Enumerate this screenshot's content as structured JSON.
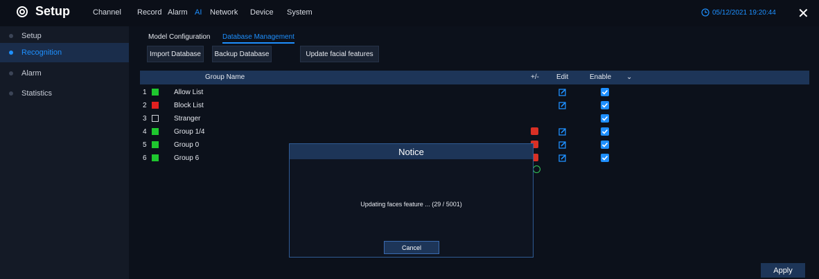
{
  "app": {
    "title": "Setup"
  },
  "menu": [
    "Channel",
    "Record",
    "Alarm",
    "AI",
    "Network",
    "Device",
    "System"
  ],
  "datetime": "05/12/2021 19:20:44",
  "sidebar": [
    "Setup",
    "Recognition",
    "Alarm",
    "Statistics"
  ],
  "subtabs": [
    "Model Configuration",
    "Database Management"
  ],
  "buttons": {
    "import": "Import Database",
    "backup": "Backup Database",
    "update": "Update facial features"
  },
  "table": {
    "headers": {
      "group_name": "Group Name",
      "plusminus": "+/-",
      "edit": "Edit",
      "enable": "Enable"
    },
    "rows": [
      {
        "num": "1",
        "color": "#1ec72e",
        "name": "Allow List",
        "deletable": false,
        "editable": true,
        "enabled": true
      },
      {
        "num": "2",
        "color": "#e02020",
        "name": "Block List",
        "deletable": false,
        "editable": true,
        "enabled": true
      },
      {
        "num": "3",
        "color": "none",
        "name": "Stranger",
        "deletable": false,
        "editable": false,
        "enabled": true
      },
      {
        "num": "4",
        "color": "#1ec72e",
        "name": "Group 1/4",
        "deletable": true,
        "editable": true,
        "enabled": true
      },
      {
        "num": "5",
        "color": "#1ec72e",
        "name": "Group 0",
        "deletable": true,
        "editable": true,
        "enabled": true
      },
      {
        "num": "6",
        "color": "#1ec72e",
        "name": "Group 6",
        "deletable": true,
        "editable": true,
        "enabled": true
      }
    ]
  },
  "dialog": {
    "title": "Notice",
    "message": "Updating faces feature ...  (29 / 5001)",
    "cancel": "Cancel"
  },
  "apply": "Apply",
  "colors": {
    "accent": "#1e90ff",
    "header": "#1d3558",
    "sidebar": "#141a26",
    "active_sidebar": "#1a2d4b"
  }
}
